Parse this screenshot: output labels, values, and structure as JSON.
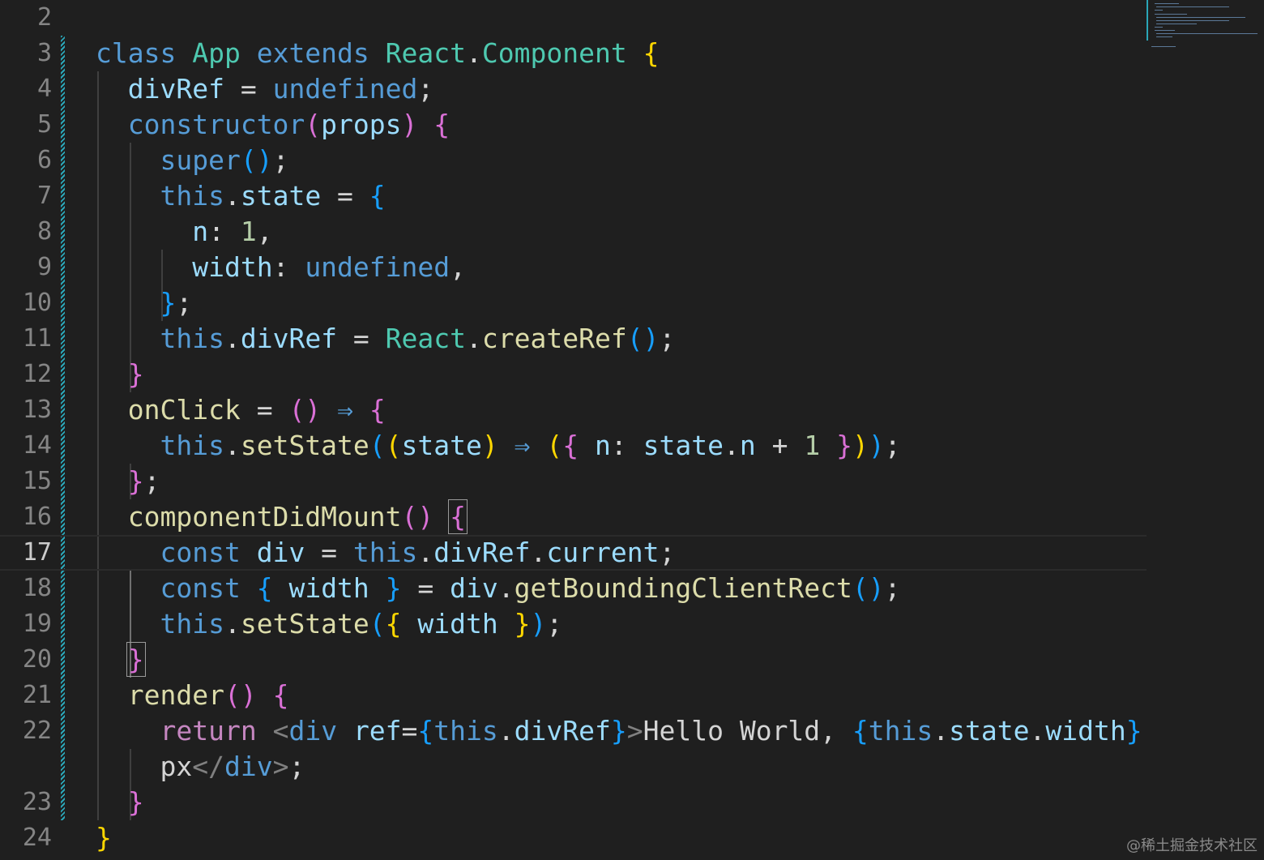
{
  "editor": {
    "language": "javascript",
    "active_line": "17",
    "colors": {
      "background": "#1f1f1f",
      "keyword": "#569cd6",
      "control": "#c586c0",
      "type": "#4ec9b0",
      "function": "#dcdcaa",
      "variable": "#9cdcfe",
      "number": "#b5cea8",
      "bracket_1": "#ffd700",
      "bracket_2": "#da70d6",
      "bracket_3": "#179fff",
      "git_modified": "#2aa6b8"
    },
    "lines": [
      {
        "num": "2",
        "tokens": []
      },
      {
        "num": "3",
        "tokens": [
          [
            "kw",
            "class"
          ],
          [
            "txt",
            " "
          ],
          [
            "ty",
            "App"
          ],
          [
            "txt",
            " "
          ],
          [
            "kw",
            "extends"
          ],
          [
            "txt",
            " "
          ],
          [
            "ty",
            "React"
          ],
          [
            "txt",
            "."
          ],
          [
            "ty",
            "Component"
          ],
          [
            "txt",
            " "
          ],
          [
            "b1",
            "{"
          ]
        ]
      },
      {
        "num": "4",
        "tokens": [
          [
            "txt",
            "  "
          ],
          [
            "vr",
            "divRef"
          ],
          [
            "txt",
            " = "
          ],
          [
            "kw",
            "undefined"
          ],
          [
            "txt",
            ";"
          ]
        ]
      },
      {
        "num": "5",
        "tokens": [
          [
            "txt",
            "  "
          ],
          [
            "kw",
            "constructor"
          ],
          [
            "b2",
            "("
          ],
          [
            "vr",
            "props"
          ],
          [
            "b2",
            ")"
          ],
          [
            "txt",
            " "
          ],
          [
            "b2",
            "{"
          ]
        ]
      },
      {
        "num": "6",
        "tokens": [
          [
            "txt",
            "    "
          ],
          [
            "kw",
            "super"
          ],
          [
            "b3",
            "()"
          ],
          [
            "txt",
            ";"
          ]
        ]
      },
      {
        "num": "7",
        "tokens": [
          [
            "txt",
            "    "
          ],
          [
            "kw",
            "this"
          ],
          [
            "txt",
            "."
          ],
          [
            "vr",
            "state"
          ],
          [
            "txt",
            " = "
          ],
          [
            "b3",
            "{"
          ]
        ]
      },
      {
        "num": "8",
        "tokens": [
          [
            "txt",
            "      "
          ],
          [
            "vr",
            "n"
          ],
          [
            "txt",
            ": "
          ],
          [
            "nm",
            "1"
          ],
          [
            "txt",
            ","
          ]
        ]
      },
      {
        "num": "9",
        "tokens": [
          [
            "txt",
            "      "
          ],
          [
            "vr",
            "width"
          ],
          [
            "txt",
            ": "
          ],
          [
            "kw",
            "undefined"
          ],
          [
            "txt",
            ","
          ]
        ]
      },
      {
        "num": "10",
        "tokens": [
          [
            "txt",
            "    "
          ],
          [
            "b3",
            "}"
          ],
          [
            "txt",
            ";"
          ]
        ]
      },
      {
        "num": "11",
        "tokens": [
          [
            "txt",
            "    "
          ],
          [
            "kw",
            "this"
          ],
          [
            "txt",
            "."
          ],
          [
            "vr",
            "divRef"
          ],
          [
            "txt",
            " = "
          ],
          [
            "ty",
            "React"
          ],
          [
            "txt",
            "."
          ],
          [
            "fn",
            "createRef"
          ],
          [
            "b3",
            "()"
          ],
          [
            "txt",
            ";"
          ]
        ]
      },
      {
        "num": "12",
        "tokens": [
          [
            "txt",
            "  "
          ],
          [
            "b2",
            "}"
          ]
        ]
      },
      {
        "num": "13",
        "tokens": [
          [
            "txt",
            "  "
          ],
          [
            "fn",
            "onClick"
          ],
          [
            "txt",
            " = "
          ],
          [
            "b2",
            "()"
          ],
          [
            "txt",
            " "
          ],
          [
            "kw",
            "⇒"
          ],
          [
            "txt",
            " "
          ],
          [
            "b2",
            "{"
          ]
        ]
      },
      {
        "num": "14",
        "tokens": [
          [
            "txt",
            "    "
          ],
          [
            "kw",
            "this"
          ],
          [
            "txt",
            "."
          ],
          [
            "fn",
            "setState"
          ],
          [
            "b3",
            "("
          ],
          [
            "b1",
            "("
          ],
          [
            "vr",
            "state"
          ],
          [
            "b1",
            ")"
          ],
          [
            "txt",
            " "
          ],
          [
            "kw",
            "⇒"
          ],
          [
            "txt",
            " "
          ],
          [
            "b1",
            "("
          ],
          [
            "b2",
            "{"
          ],
          [
            "txt",
            " "
          ],
          [
            "vr",
            "n"
          ],
          [
            "txt",
            ": "
          ],
          [
            "vr",
            "state"
          ],
          [
            "txt",
            "."
          ],
          [
            "vr",
            "n"
          ],
          [
            "txt",
            " + "
          ],
          [
            "nm",
            "1"
          ],
          [
            "txt",
            " "
          ],
          [
            "b2",
            "}"
          ],
          [
            "b1",
            ")"
          ],
          [
            "b3",
            ")"
          ],
          [
            "txt",
            ";"
          ]
        ]
      },
      {
        "num": "15",
        "tokens": [
          [
            "txt",
            "  "
          ],
          [
            "b2",
            "}"
          ],
          [
            "txt",
            ";"
          ]
        ]
      },
      {
        "num": "16",
        "tokens": [
          [
            "txt",
            "  "
          ],
          [
            "fn",
            "componentDidMount"
          ],
          [
            "b2",
            "()"
          ],
          [
            "txt",
            " "
          ],
          [
            "b2",
            "{"
          ]
        ]
      },
      {
        "num": "17",
        "tokens": [
          [
            "txt",
            "    "
          ],
          [
            "kw",
            "const"
          ],
          [
            "txt",
            " "
          ],
          [
            "vr",
            "div"
          ],
          [
            "txt",
            " = "
          ],
          [
            "kw",
            "this"
          ],
          [
            "txt",
            "."
          ],
          [
            "vr",
            "divRef"
          ],
          [
            "txt",
            "."
          ],
          [
            "vr",
            "current"
          ],
          [
            "txt",
            ";"
          ]
        ]
      },
      {
        "num": "18",
        "tokens": [
          [
            "txt",
            "    "
          ],
          [
            "kw",
            "const"
          ],
          [
            "txt",
            " "
          ],
          [
            "b3",
            "{"
          ],
          [
            "txt",
            " "
          ],
          [
            "vr",
            "width"
          ],
          [
            "txt",
            " "
          ],
          [
            "b3",
            "}"
          ],
          [
            "txt",
            " = "
          ],
          [
            "vr",
            "div"
          ],
          [
            "txt",
            "."
          ],
          [
            "fn",
            "getBoundingClientRect"
          ],
          [
            "b3",
            "()"
          ],
          [
            "txt",
            ";"
          ]
        ]
      },
      {
        "num": "19",
        "tokens": [
          [
            "txt",
            "    "
          ],
          [
            "kw",
            "this"
          ],
          [
            "txt",
            "."
          ],
          [
            "fn",
            "setState"
          ],
          [
            "b3",
            "("
          ],
          [
            "b1",
            "{"
          ],
          [
            "txt",
            " "
          ],
          [
            "vr",
            "width"
          ],
          [
            "txt",
            " "
          ],
          [
            "b1",
            "}"
          ],
          [
            "b3",
            ")"
          ],
          [
            "txt",
            ";"
          ]
        ]
      },
      {
        "num": "20",
        "tokens": [
          [
            "txt",
            "  "
          ],
          [
            "b2",
            "}"
          ]
        ]
      },
      {
        "num": "21",
        "tokens": [
          [
            "txt",
            "  "
          ],
          [
            "fn",
            "render"
          ],
          [
            "b2",
            "()"
          ],
          [
            "txt",
            " "
          ],
          [
            "b2",
            "{"
          ]
        ]
      },
      {
        "num": "22",
        "tokens": [
          [
            "txt",
            "    "
          ],
          [
            "ct",
            "return"
          ],
          [
            "txt",
            " "
          ],
          [
            "tb",
            "<"
          ],
          [
            "tg",
            "div"
          ],
          [
            "txt",
            " "
          ],
          [
            "vr",
            "ref"
          ],
          [
            "txt",
            "="
          ],
          [
            "b3",
            "{"
          ],
          [
            "kw",
            "this"
          ],
          [
            "txt",
            "."
          ],
          [
            "vr",
            "divRef"
          ],
          [
            "b3",
            "}"
          ],
          [
            "tb",
            ">"
          ],
          [
            "txt",
            "Hello World, "
          ],
          [
            "b3",
            "{"
          ],
          [
            "kw",
            "this"
          ],
          [
            "txt",
            "."
          ],
          [
            "vr",
            "state"
          ],
          [
            "txt",
            "."
          ],
          [
            "vr",
            "width"
          ],
          [
            "b3",
            "}"
          ]
        ]
      },
      {
        "num": "",
        "tokens": [
          [
            "txt",
            "    px"
          ],
          [
            "tb",
            "</"
          ],
          [
            "tg",
            "div"
          ],
          [
            "tb",
            ">"
          ],
          [
            "txt",
            ";"
          ]
        ]
      },
      {
        "num": "23",
        "tokens": [
          [
            "txt",
            "  "
          ],
          [
            "b2",
            "}"
          ]
        ]
      },
      {
        "num": "24",
        "tokens": [
          [
            "b1",
            "}"
          ]
        ]
      }
    ]
  },
  "watermark": "@稀土掘金技术社区"
}
